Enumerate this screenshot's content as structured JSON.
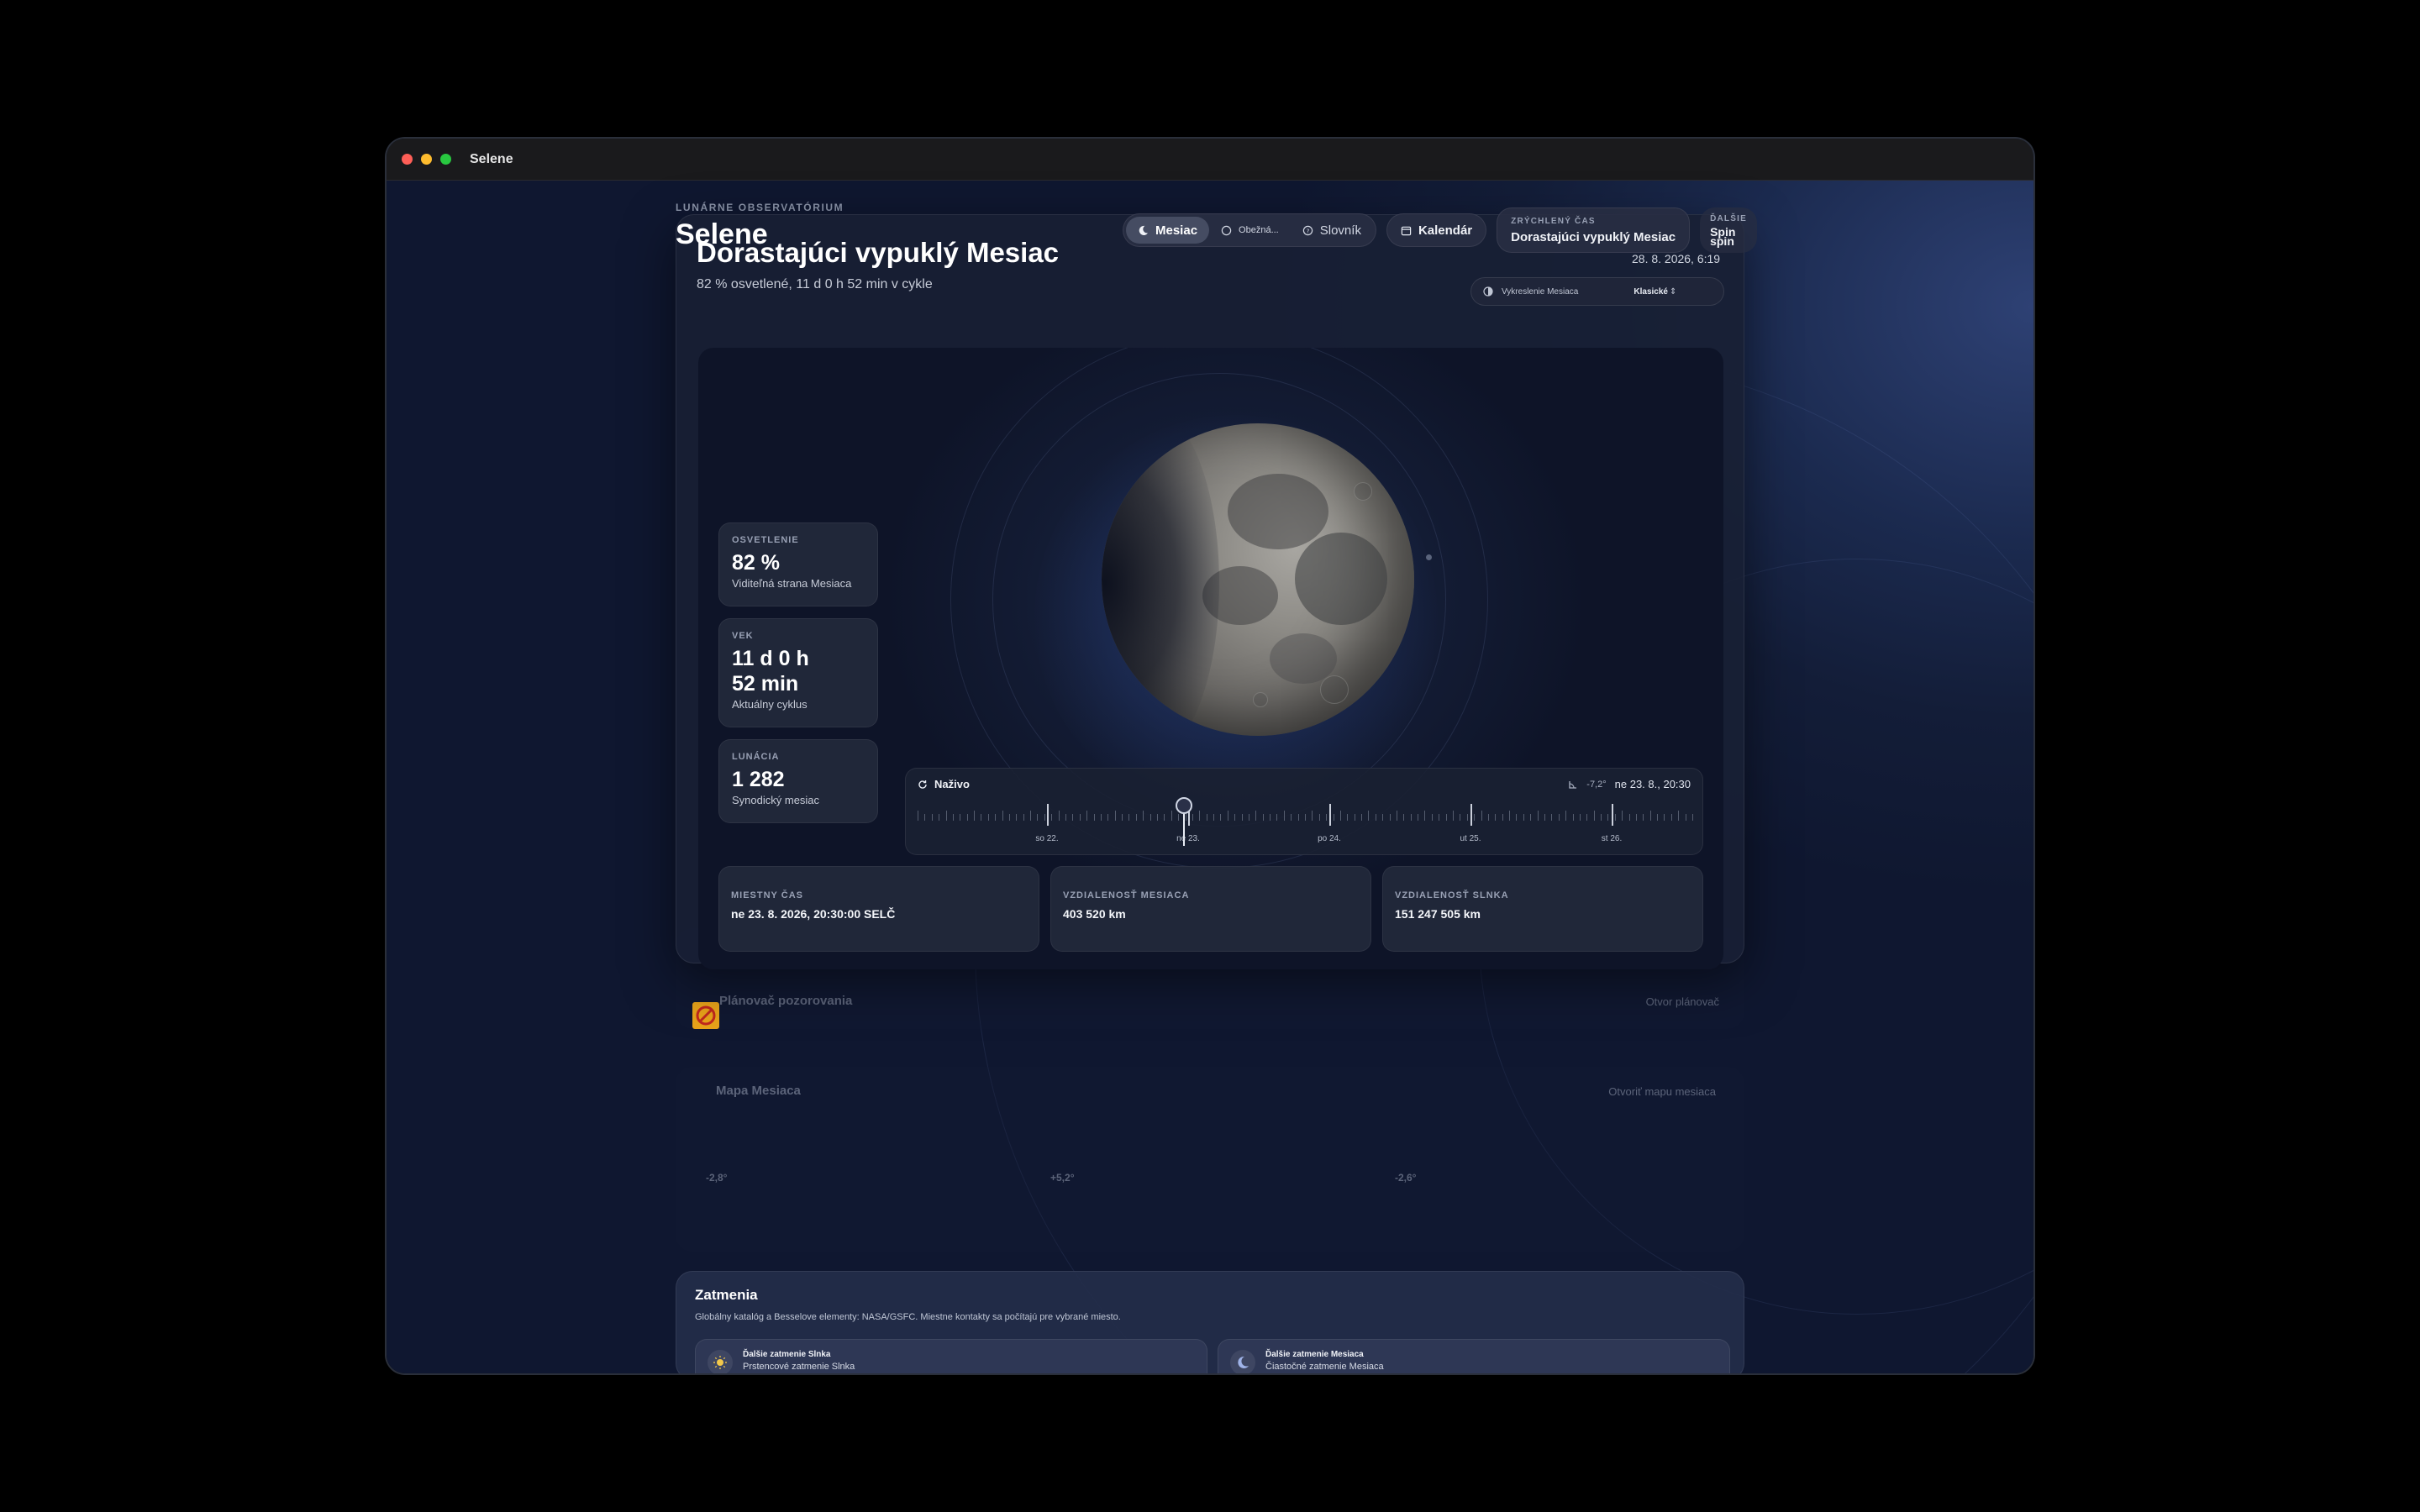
{
  "window": {
    "title": "Selene"
  },
  "app": {
    "eyebrow": "LUNÁRNE OBSERVATÓRIUM",
    "name": "Selene"
  },
  "phase": {
    "title": "Dorastajúci vypuklý Mesiac",
    "subtitle": "82 % osvetlené, 11 d 0 h 52 min v cykle"
  },
  "toolbar": {
    "tabs": [
      {
        "label": "Mesiac",
        "icon": "moon-icon",
        "active": true
      },
      {
        "label": "Obežná...",
        "icon": "orbit-icon",
        "active": false
      },
      {
        "label": "Slovník",
        "icon": "glossary-icon",
        "active": false
      }
    ],
    "calendar_label": "Kalendár",
    "time_label": "ZRÝCHLENÝ ČAS",
    "time_value": "Dorastajúci vypuklý Mesiac",
    "more_label": "ĎALŠIE",
    "more_value": "Spin",
    "more_value2": "spin"
  },
  "date_line": "28. 8. 2026, 6:19",
  "render": {
    "label": "Vykreslenie Mesiaca",
    "value": "Klasické"
  },
  "stats": [
    {
      "label": "OSVETLENIE",
      "value": "82 %",
      "desc": "Viditeľná strana Mesiaca"
    },
    {
      "label": "VEK",
      "value_line1": "11 d 0 h",
      "value_line2": "52 min",
      "desc": "Aktuálny cyklus"
    },
    {
      "label": "LUNÁCIA",
      "value": "1 282",
      "desc": "Synodický mesiac"
    }
  ],
  "timeline": {
    "live_label": "Naživo",
    "angle": "-7,2°",
    "current": "ne 23. 8., 20:30",
    "days": [
      "so 22.",
      "ne 23.",
      "po 24.",
      "ut 25.",
      "st 26."
    ],
    "position": 0.5
  },
  "info": [
    {
      "label": "MIESTNY ČAS",
      "value": "ne 23. 8. 2026, 20:30:00 SELČ"
    },
    {
      "label": "VZDIALENOSŤ MESIACA",
      "value": "403 520 km"
    },
    {
      "label": "VZDIALENOSŤ SLNKA",
      "value": "151 247 505 km"
    }
  ],
  "planner": {
    "title": "Plánovač pozorovania",
    "button": "Otvor plánovač"
  },
  "moonmap": {
    "title": "Mapa Mesiaca",
    "button": "Otvoriť mapu mesiaca",
    "values": [
      "-2,8°",
      "+5,2°",
      "-2,6°"
    ]
  },
  "eclipses": {
    "title": "Zatmenia",
    "subtitle": "Globálny katalóg a Besselove elementy: NASA/GSFC. Miestne kontakty sa počítajú pre vybrané miesto.",
    "solar": {
      "label": "Ďalšie zatmenie Slnka",
      "value": "Prstencové zatmenie Slnka"
    },
    "lunar": {
      "label": "Ďalšie zatmenie Mesiaca",
      "value": "Čiastočné zatmenie Mesiaca"
    }
  },
  "colors": {
    "accent": "#fe5f57",
    "background": "#131d38"
  }
}
